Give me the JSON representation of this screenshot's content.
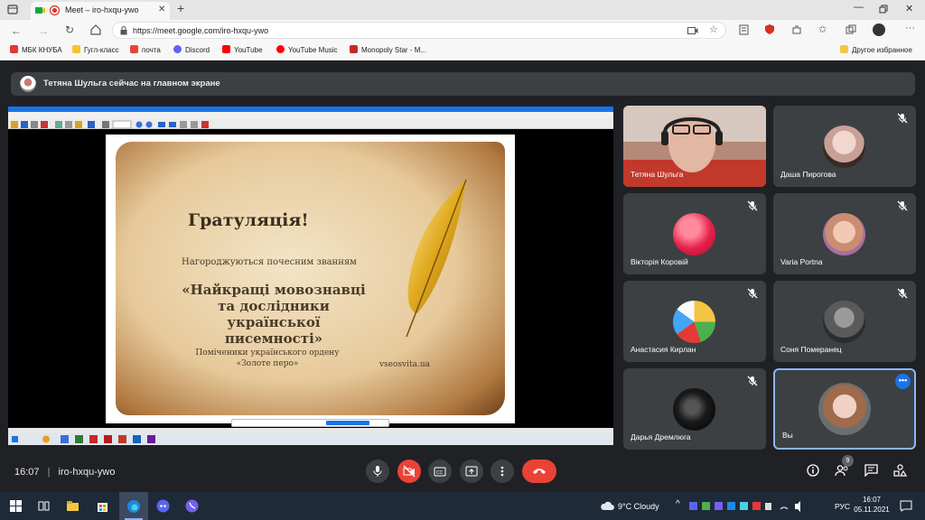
{
  "browser": {
    "tab_title": "Meet – iro-hxqu-ywo",
    "url": "https://meet.google.com/iro-hxqu-ywo",
    "bookmarks": [
      {
        "label": "МБК КНУБА",
        "color": "#e53935"
      },
      {
        "label": "Гугл-класс",
        "color": "#fbc02d"
      },
      {
        "label": "почта",
        "color": "#ea4335"
      },
      {
        "label": "Discord",
        "color": "#5865f2"
      },
      {
        "label": "YouTube",
        "color": "#ff0000"
      },
      {
        "label": "YouTube Music",
        "color": "#ff0000"
      },
      {
        "label": "Monopoly Star - M...",
        "color": "#c62828"
      }
    ],
    "other_bookmarks": "Другое избранное"
  },
  "meet": {
    "banner": "Тетяна Шульга сейчас на главном экране",
    "time": "16:07",
    "code": "iro-hxqu-ywo",
    "participants_count": "9"
  },
  "slide": {
    "title": "Гратуляція!",
    "subtitle": "Нагороджуються почесним званням",
    "line1": "«Найкращі мовознавці",
    "line2": "та дослідники української",
    "line3": "писемності»",
    "note1": "Поміченики українського ордену",
    "note2": "«Золоте перо»",
    "site": "vseosvita.ua"
  },
  "tiles": [
    {
      "name": "Тетяна Шульга",
      "muted": false
    },
    {
      "name": "Даша Пирогова",
      "muted": true
    },
    {
      "name": "Вікторія Коровій",
      "muted": true
    },
    {
      "name": "Varia Portna",
      "muted": true
    },
    {
      "name": "Анастасия Кирлан",
      "muted": true
    },
    {
      "name": "Соня Померанец",
      "muted": true
    },
    {
      "name": "Дарья Дремлюга",
      "muted": true
    },
    {
      "name": "Вы",
      "muted": false
    }
  ],
  "taskbar": {
    "weather": "9°C  Cloudy",
    "lang": "РУС",
    "clock_time": "16:07",
    "clock_date": "05.11.2021"
  },
  "colors": {
    "meet_bg": "#202124",
    "tile_bg": "#3c4043",
    "hangup": "#ea4335",
    "accent": "#1a73e8"
  }
}
